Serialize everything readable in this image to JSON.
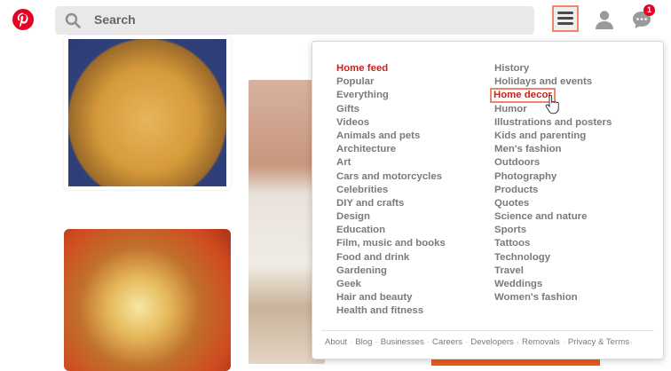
{
  "header": {
    "search_placeholder": "Search",
    "notification_count": "1",
    "icons": [
      "pinterest-logo",
      "search-icon",
      "menu-icon",
      "user-icon",
      "messages-icon"
    ],
    "brand_color": "#e60023"
  },
  "menu": {
    "column1": [
      "Home feed",
      "Popular",
      "Everything",
      "Gifts",
      "Videos",
      "Animals and pets",
      "Architecture",
      "Art",
      "Cars and motorcycles",
      "Celebrities",
      "DIY and crafts",
      "Design",
      "Education",
      "Film, music and books",
      "Food and drink",
      "Gardening",
      "Geek",
      "Hair and beauty",
      "Health and fitness"
    ],
    "column2": [
      "History",
      "Holidays and events",
      "Home decor",
      "Humor",
      "Illustrations and posters",
      "Kids and parenting",
      "Men's fashion",
      "Outdoors",
      "Photography",
      "Products",
      "Quotes",
      "Science and nature",
      "Sports",
      "Tattoos",
      "Technology",
      "Travel",
      "Weddings",
      "Women's fashion"
    ],
    "active_item": "Home feed",
    "hovered_item": "Home decor"
  },
  "footer": {
    "links": [
      "About",
      "Blog",
      "Businesses",
      "Careers",
      "Developers",
      "Removals",
      "Privacy & Terms"
    ]
  }
}
